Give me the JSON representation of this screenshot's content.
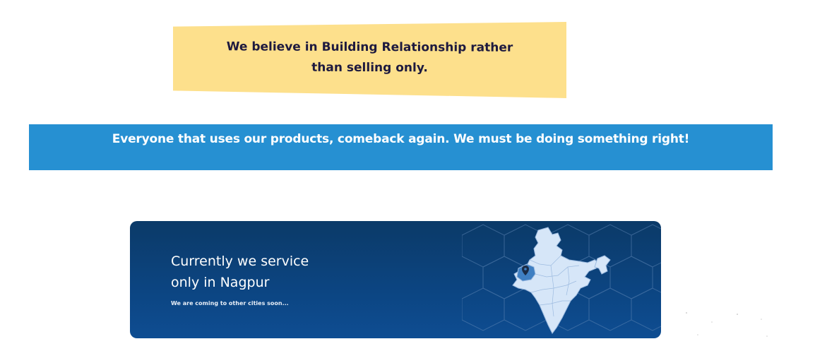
{
  "note": {
    "text": "We believe in Building Relationship rather than selling only."
  },
  "banner": {
    "text": "Everyone that uses our products, comeback again. We must be doing something right!"
  },
  "service": {
    "title_line1": "Currently we service",
    "title_line2": "only in Nagpur",
    "subtitle": "We are coming to other cities soon...",
    "map_icon": "india-map-icon",
    "pin_icon": "location-pin-icon"
  },
  "colors": {
    "note_bg": "#fde08c",
    "banner_bg": "#2690d2",
    "card_bg": "#0c4582",
    "map_fill": "#d6e6f8",
    "highlight_state": "#3f7fc2"
  }
}
